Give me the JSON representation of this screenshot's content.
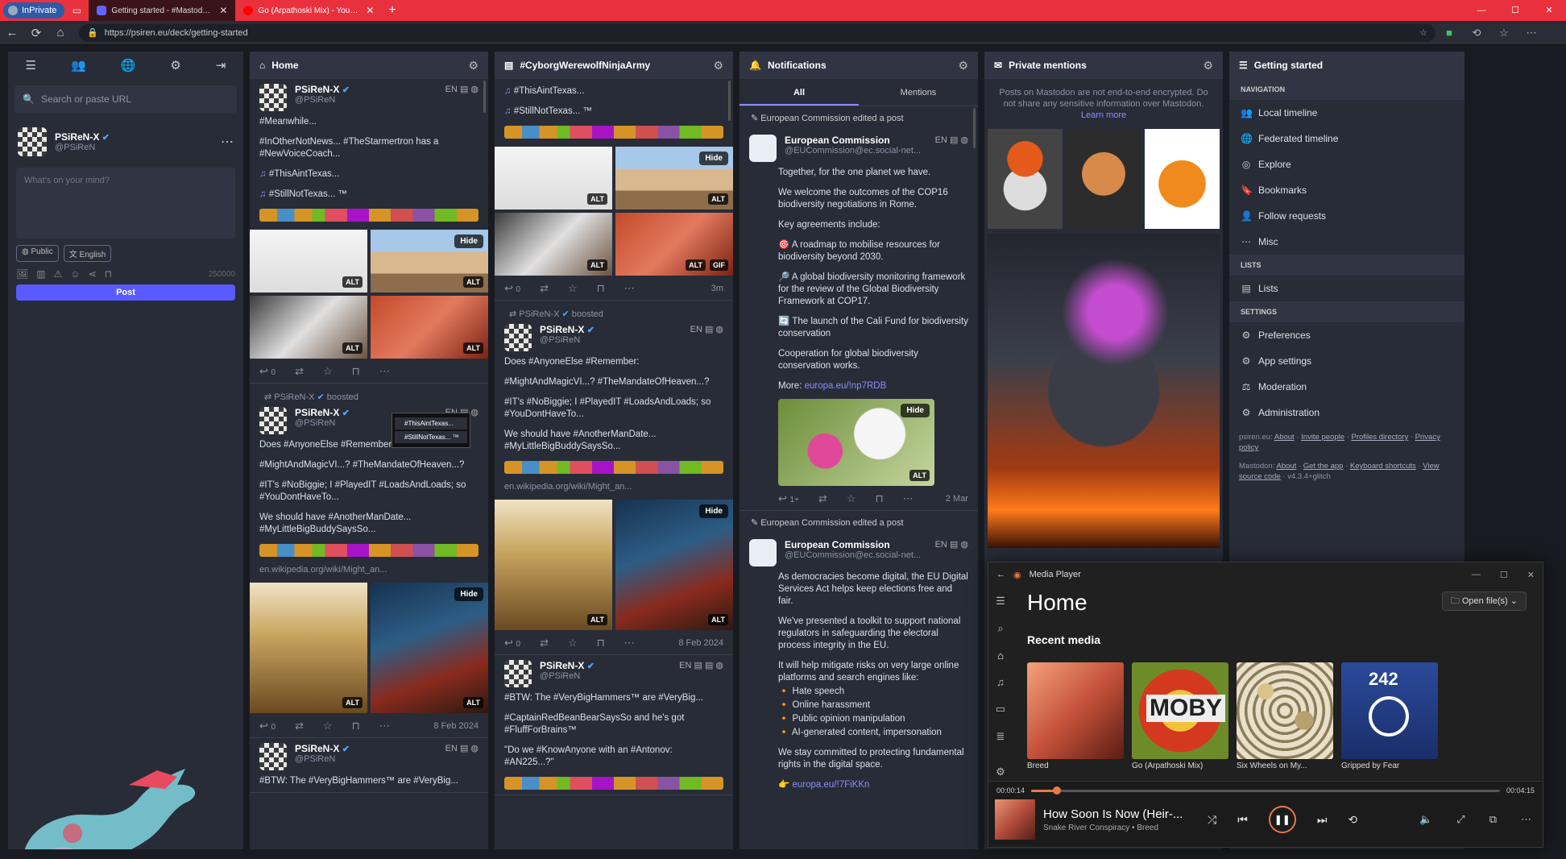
{
  "browser": {
    "inprivate": "InPrivate",
    "tabs": [
      {
        "title": "Getting started - #MastodonSpy!"
      },
      {
        "title": "Go (Arpathoski Mix) - YouTube"
      }
    ],
    "url": "https://psiren.eu/deck/getting-started"
  },
  "colors": {
    "accent": "#595aff",
    "tabbar": "#e8313d",
    "link": "#8c8dff",
    "player_accent": "#e8794a"
  },
  "left": {
    "search_placeholder": "Search or paste URL",
    "user_name": "PSiReN-X",
    "user_acct": "@PSiReN",
    "compose_placeholder": "What's on your mind?",
    "visibility": "Public",
    "language": "English",
    "char_count": "250000",
    "post_label": "Post"
  },
  "home": {
    "title": "Home",
    "s1": {
      "name": "PSiReN-X",
      "acct": "@PSiReN",
      "lang": "EN",
      "t1": "#Meanwhile...",
      "t2": "#InOtherNotNews... #TheStarmertron has a #NewVoiceCoach...",
      "t3": "#ThisAintTexas...",
      "t4": "#StillNotTexas... ™",
      "replies": "0"
    },
    "tooltip": [
      "#ThisAintTexas...",
      "#StillNotTexas... ™"
    ],
    "s2": {
      "boosted_by": "PSiReN-X",
      "boosted": "boosted",
      "name": "PSiReN-X",
      "acct": "@PSiReN",
      "lang": "EN",
      "t1": "Does #AnyoneElse #Remember:",
      "t2": "#MightAndMagicVI...? #TheMandateOfHeaven...?",
      "t3": "#IT's #NoBiggie; I #PlayedIT #LoadsAndLoads; so #YouDontHaveTo...",
      "t4": "We should have #AnotherManDate... #MyLittleBigBuddySaysSo...",
      "link": "en.wikipedia.org/wiki/Might_an...",
      "replies": "0",
      "date": "8 Feb 2024"
    },
    "s3": {
      "name": "PSiReN-X",
      "acct": "@PSiReN",
      "lang": "EN",
      "t1": "#BTW: The #VeryBigHammers™ are #VeryBig..."
    }
  },
  "hashtag": {
    "title": "#CyborgWerewolfNinjaArmy",
    "s1": {
      "t3": "#ThisAintTexas...",
      "t4": "#StillNotTexas... ™",
      "replies": "0",
      "date": "3m"
    },
    "s2": {
      "boosted_by": "PSiReN-X",
      "boosted": "boosted",
      "name": "PSiReN-X",
      "acct": "@PSiReN",
      "lang": "EN",
      "t1": "Does #AnyoneElse #Remember:",
      "t2": "#MightAndMagicVI...? #TheMandateOfHeaven...?",
      "t3": "#IT's #NoBiggie; I #PlayedIT #LoadsAndLoads; so #YouDontHaveTo...",
      "t4": "We should have #AnotherManDate... #MyLittleBigBuddySaysSo...",
      "link": "en.wikipedia.org/wiki/Might_an...",
      "replies": "0",
      "date": "8 Feb 2024"
    },
    "s3": {
      "name": "PSiReN-X",
      "acct": "@PSiReN",
      "lang": "EN",
      "t1": "#BTW: The #VeryBigHammers™ are #VeryBig...",
      "t2": "#CaptainRedBeanBearSaysSo and he's got #FluffForBrains™",
      "t3": "\"Do we #KnowAnyone with an #Antonov: #AN225...?\""
    }
  },
  "notifications": {
    "title": "Notifications",
    "tab_all": "All",
    "tab_mentions": "Mentions",
    "n1": {
      "header": "European Commission edited a post",
      "name": "European Commission",
      "acct": "@EUCommission@ec.social-net...",
      "lang": "EN",
      "p1": "Together, for the one planet we have.",
      "p2": "We welcome the outcomes of the COP16 biodiversity negotiations in Rome.",
      "p3": "Key agreements include:",
      "p4": "🎯 A roadmap to mobilise resources for biodiversity beyond 2030.",
      "p5": "🔎 A global biodiversity monitoring framework for the review of the Global Biodiversity Framework at COP17.",
      "p6": "🔄 The launch of the Cali Fund for biodiversity conservation",
      "p7": "Cooperation for global biodiversity conservation works.",
      "more_label": "More:",
      "more_link": "europa.eu/!np7RDB",
      "replies": "1+",
      "date": "2 Mar"
    },
    "n2": {
      "header": "European Commission edited a post",
      "name": "European Commission",
      "acct": "@EUCommission@ec.social-net...",
      "lang": "EN",
      "p1": "As democracies become digital, the EU Digital Services Act helps keep elections free and fair.",
      "p2": "We've presented a toolkit to support national regulators in safeguarding the electoral process integrity in the EU.",
      "p3": "It will help mitigate risks on very large online platforms and search engines like:",
      "b1": "🔸 Hate speech",
      "b2": "🔸 Online harassment",
      "b3": "🔸 Public opinion manipulation",
      "b4": "🔸 AI-generated content, impersonation",
      "p4": "We stay committed to protecting fundamental rights in the digital space.",
      "link": "europa.eu/!7FiKKn"
    }
  },
  "private": {
    "title": "Private mentions",
    "info": "Posts on Mastodon are not end-to-end encrypted. Do not share any sensitive information over Mastodon.",
    "learn": "Learn more"
  },
  "getting_started": {
    "title": "Getting started",
    "sec_nav": "Navigation",
    "items_nav": [
      {
        "label": "Local timeline"
      },
      {
        "label": "Federated timeline"
      },
      {
        "label": "Explore"
      },
      {
        "label": "Bookmarks"
      },
      {
        "label": "Follow requests"
      },
      {
        "label": "Misc"
      }
    ],
    "sec_lists": "Lists",
    "lists_label": "Lists",
    "sec_settings": "Settings",
    "items_settings": [
      {
        "label": "Preferences"
      },
      {
        "label": "App settings"
      },
      {
        "label": "Moderation"
      },
      {
        "label": "Administration"
      }
    ],
    "foot1": {
      "site": "psiren.eu:",
      "about": "About",
      "invite": "Invite people",
      "profiles": "Profiles directory",
      "privacy": "Privacy policy"
    },
    "foot2": {
      "site": "Mastodon:",
      "about": "About",
      "app": "Get the app",
      "keys": "Keyboard shortcuts",
      "source": "View source code",
      "version": "v4.3.4+glitch"
    }
  },
  "player": {
    "app": "Media Player",
    "title": "Home",
    "open": "Open file(s)",
    "recent": "Recent media",
    "albums": [
      {
        "caption": "Breed"
      },
      {
        "caption": "Go (Arpathoski Mix)"
      },
      {
        "caption": "Six Wheels on My..."
      },
      {
        "caption": "Gripped by Fear"
      }
    ],
    "album_texts": {
      "moby": "MOBY",
      "t242": "242"
    },
    "elapsed": "00:00:14",
    "total": "00:04:15",
    "progress": 0.055,
    "track": "How Soon Is Now (Heir-...",
    "artist": "Snake River Conspiracy • Breed"
  }
}
